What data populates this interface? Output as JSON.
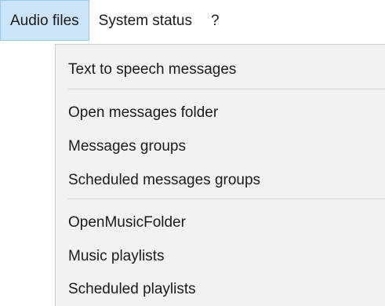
{
  "menubar": {
    "items": [
      {
        "label": "Audio files"
      },
      {
        "label": "System status"
      },
      {
        "label": "?"
      }
    ]
  },
  "dropdown": {
    "items": [
      {
        "label": "Text to speech messages"
      },
      {
        "label": "Open messages folder"
      },
      {
        "label": "Messages groups"
      },
      {
        "label": "Scheduled messages groups"
      },
      {
        "label": "OpenMusicFolder"
      },
      {
        "label": "Music playlists"
      },
      {
        "label": "Scheduled playlists"
      }
    ]
  }
}
